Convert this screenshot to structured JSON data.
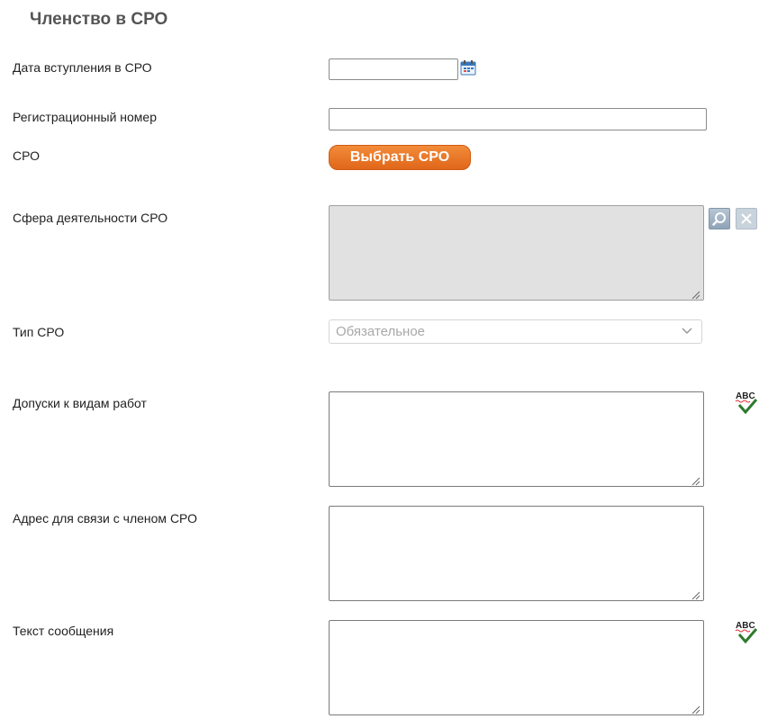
{
  "section": {
    "title": "Членство в СРО"
  },
  "fields": {
    "join_date": {
      "label": "Дата вступления в СРО",
      "value": ""
    },
    "reg_number": {
      "label": "Регистрационный номер",
      "value": ""
    },
    "sro": {
      "label": "СРО",
      "button": "Выбрать СРО"
    },
    "activity_scope": {
      "label": "Сфера деятельности СРО",
      "value": ""
    },
    "sro_type": {
      "label": "Тип СРО",
      "selected": "Обязательное"
    },
    "work_permits": {
      "label": "Допуски к видам работ",
      "value": ""
    },
    "contact_address": {
      "label": "Адрес для связи с членом СРО",
      "value": ""
    },
    "message_text": {
      "label": "Текст сообщения",
      "value": ""
    }
  },
  "icons": {
    "calendar": "calendar-icon",
    "search": "search-icon",
    "clear": "close-icon",
    "spellcheck": "spellcheck-icon",
    "select_arrow": "chevron-down-icon",
    "resize": "resize-grip-icon"
  },
  "colors": {
    "accent": "#e8731f",
    "readonly_bg": "#e1e1e1",
    "title": "#555555",
    "icon_blue": "#4a90c8"
  }
}
